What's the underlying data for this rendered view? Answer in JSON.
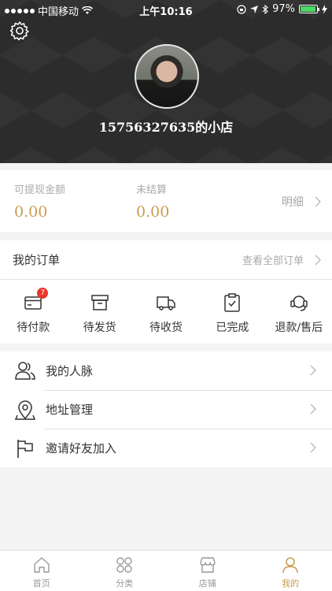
{
  "status_bar": {
    "carrier": "中国移动",
    "time": "上午10:16",
    "battery": "97%",
    "battery_level": 0.97,
    "icons": [
      "signal-dots-icon",
      "wifi-icon",
      "lock-rotation-icon",
      "location-arrow-icon",
      "bluetooth-icon",
      "battery-icon",
      "charging-icon"
    ]
  },
  "header": {
    "shop_name": "15756327635的小店",
    "settings_icon": "gear-icon",
    "avatar": "user-avatar"
  },
  "balance": {
    "withdrawable_label": "可提现金额",
    "withdrawable_value": "0.00",
    "unsettled_label": "未结算",
    "unsettled_value": "0.00",
    "detail_label": "明细",
    "value_color": "#c99b4e"
  },
  "orders": {
    "title": "我的订单",
    "view_all": "查看全部订单",
    "items": [
      {
        "label": "待付款",
        "icon": "card-icon",
        "badge": "7"
      },
      {
        "label": "待发货",
        "icon": "box-icon"
      },
      {
        "label": "待收货",
        "icon": "truck-icon"
      },
      {
        "label": "已完成",
        "icon": "clipboard-check-icon"
      },
      {
        "label": "退款/售后",
        "icon": "headset-icon"
      }
    ]
  },
  "menu": {
    "items": [
      {
        "label": "我的人脉",
        "icon": "contacts-icon"
      },
      {
        "label": "地址管理",
        "icon": "location-pin-icon"
      },
      {
        "label": "邀请好友加入",
        "icon": "flag-icon"
      }
    ]
  },
  "tabbar": {
    "tabs": [
      {
        "label": "首页",
        "icon": "home-icon"
      },
      {
        "label": "分类",
        "icon": "category-icon"
      },
      {
        "label": "店铺",
        "icon": "store-icon"
      },
      {
        "label": "我的",
        "icon": "person-icon",
        "active": true
      }
    ],
    "active_color": "#c99b4e"
  }
}
